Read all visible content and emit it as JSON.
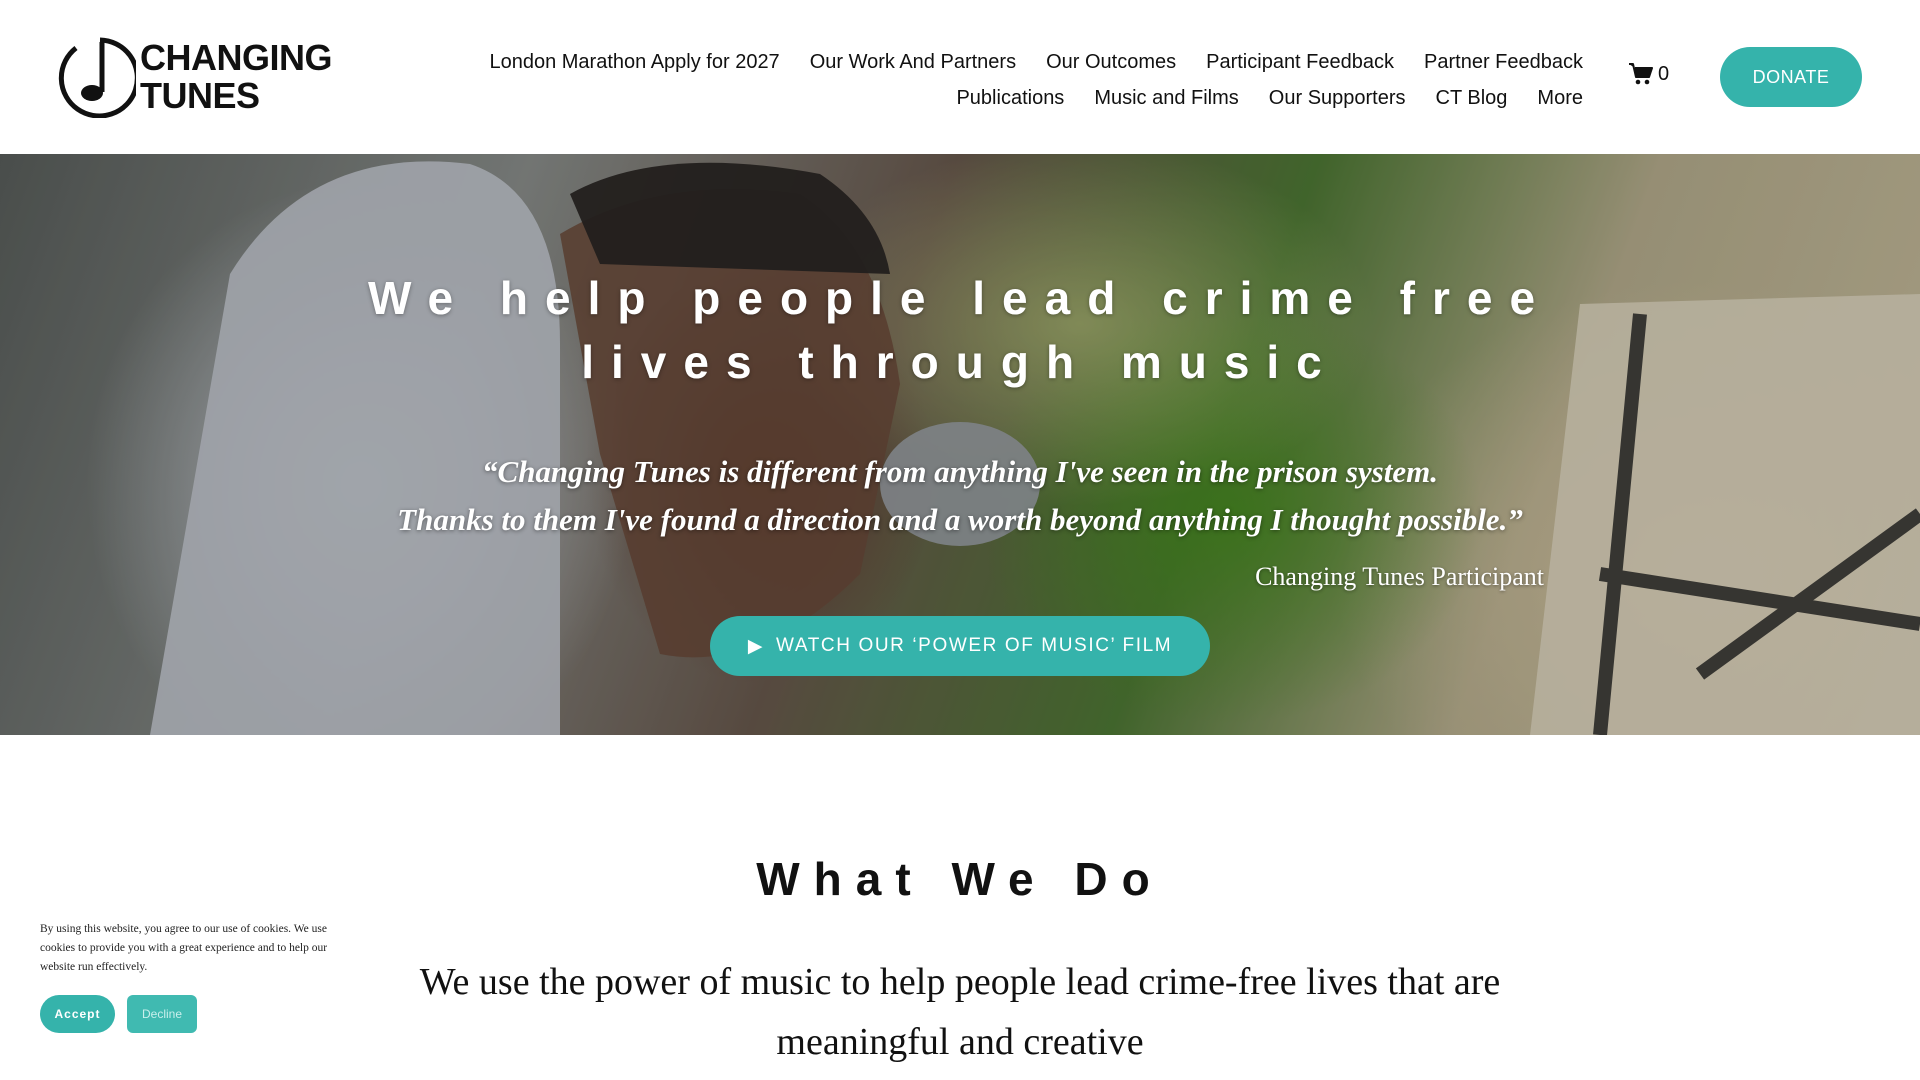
{
  "brand": {
    "logo_line1": "CHANGING",
    "logo_line2": "TUNES",
    "logo_icon": "music-note-circle-icon"
  },
  "nav": {
    "row1": [
      {
        "label": "London Marathon Apply for 2027"
      },
      {
        "label": "Our Work And Partners"
      },
      {
        "label": "Our Outcomes"
      },
      {
        "label": "Participant Feedback"
      },
      {
        "label": "Partner Feedback"
      }
    ],
    "row2": [
      {
        "label": "Publications"
      },
      {
        "label": "Music and Films"
      },
      {
        "label": "Our Supporters"
      },
      {
        "label": "CT Blog"
      },
      {
        "label": "More"
      }
    ]
  },
  "cart": {
    "icon": "cart-icon",
    "count": "0"
  },
  "donate_label": "DONATE",
  "hero": {
    "title_line1": "We help people lead crime free",
    "title_line2": "lives through music",
    "quote_line1": "“Changing Tunes is different from anything I've seen in the prison system.",
    "quote_line2": "Thanks to them I've found a direction and a worth beyond anything I thought possible.”",
    "attribution": "Changing Tunes Participant",
    "film_button_icon": "▶",
    "film_button_label": "WATCH OUR ‘POWER OF MUSIC’ FILM"
  },
  "what_we_do": {
    "title": "What We Do",
    "body_line1": "We use the power of music to help people lead crime-free lives that are",
    "body_line2": "meaningful and creative"
  },
  "cookie": {
    "text": "By using this website, you agree to our use of cookies. We use cookies to provide you with a great experience and to help our website run effectively.",
    "accept_label": "Accept",
    "decline_label": "Decline"
  },
  "colors": {
    "accent": "#35b3ab",
    "text": "#111111",
    "background": "#ffffff"
  }
}
